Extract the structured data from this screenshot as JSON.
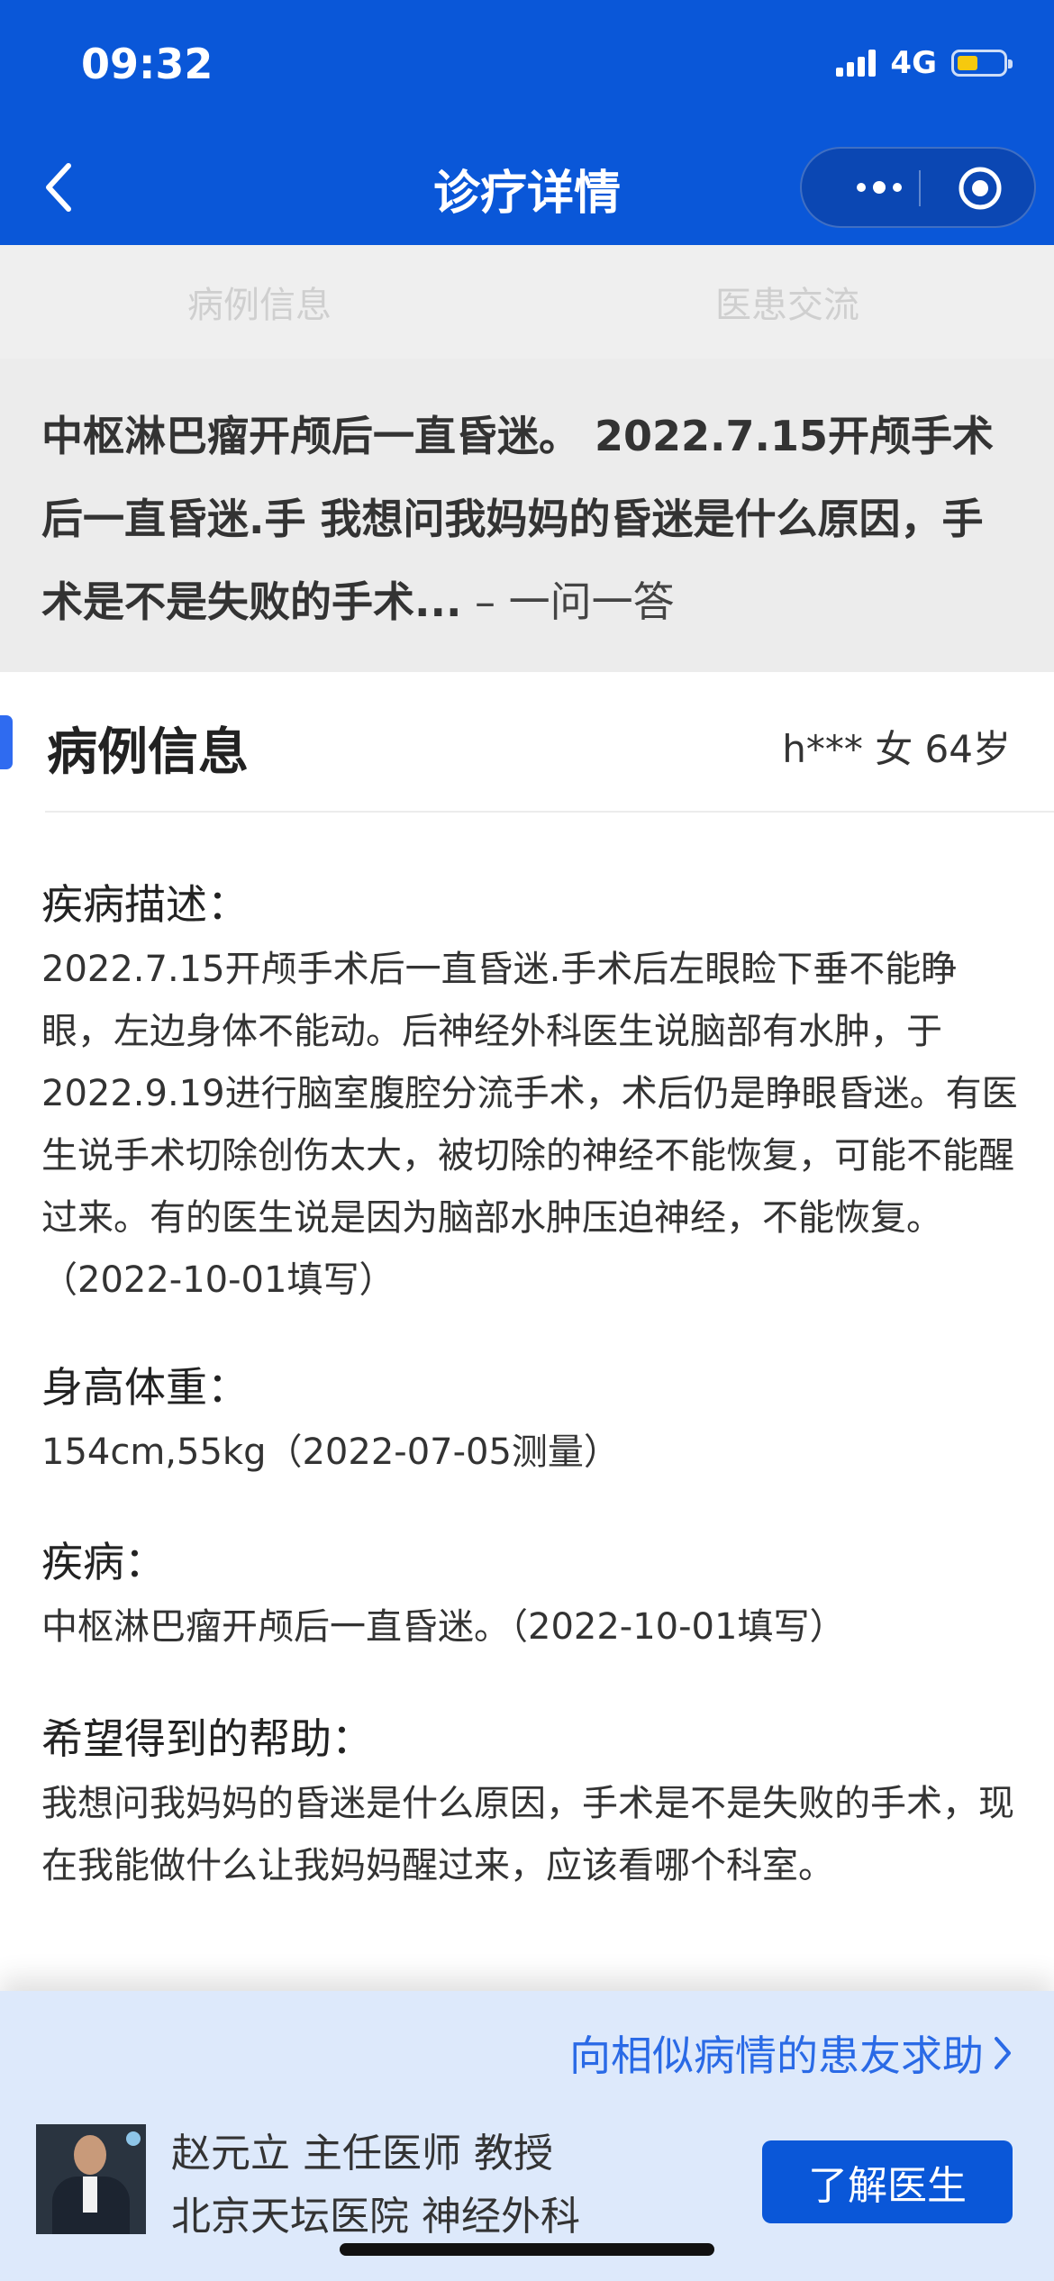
{
  "status_bar": {
    "time": "09:32",
    "network": "4G"
  },
  "nav": {
    "title": "诊疗详情"
  },
  "tabs": [
    {
      "label": "病例信息"
    },
    {
      "label": "医患交流"
    }
  ],
  "question": {
    "text": "中枢淋巴瘤开颅后一直昏迷。 2022.7.15开颅手术后一直昏迷.手 我想问我妈妈的昏迷是什么原因，手术是不是失败的手术...",
    "suffix": " – 一问一答"
  },
  "case": {
    "section_title": "病例信息",
    "patient": "h*** 女 64岁",
    "disease_desc_label": "疾病描述：",
    "disease_desc": "2022.7.15开颅手术后一直昏迷.手术后左眼睑下垂不能睁眼，左边身体不能动。后神经外科医生说脑部有水肿，于2022.9.19进行脑室腹腔分流手术，术后仍是睁眼昏迷。有医生说手术切除创伤太大，被切除的神经不能恢复，可能不能醒过来。有的医生说是因为脑部水肿压迫神经，不能恢复。（2022-10-01填写）",
    "height_weight_label": "身高体重：",
    "height_weight": "154cm,55kg（2022-07-05测量）",
    "disease_label": "疾病：",
    "disease": "中枢淋巴瘤开颅后一直昏迷。（2022-10-01填写）",
    "help_label": "希望得到的帮助：",
    "help": "我想问我妈妈的昏迷是什么原因，手术是不是失败的手术，现在我能做什么让我妈妈醒过来，应该看哪个科室。"
  },
  "bottom": {
    "help_link": "向相似病情的患友求助",
    "doctor_line1": "赵元立 主任医师 教授",
    "doctor_line2": "北京天坛医院 神经外科",
    "button": "了解医生"
  },
  "colors": {
    "brand_blue": "#0a57d8",
    "link_blue": "#2a6ae6",
    "accent": "#2f6bf0"
  }
}
